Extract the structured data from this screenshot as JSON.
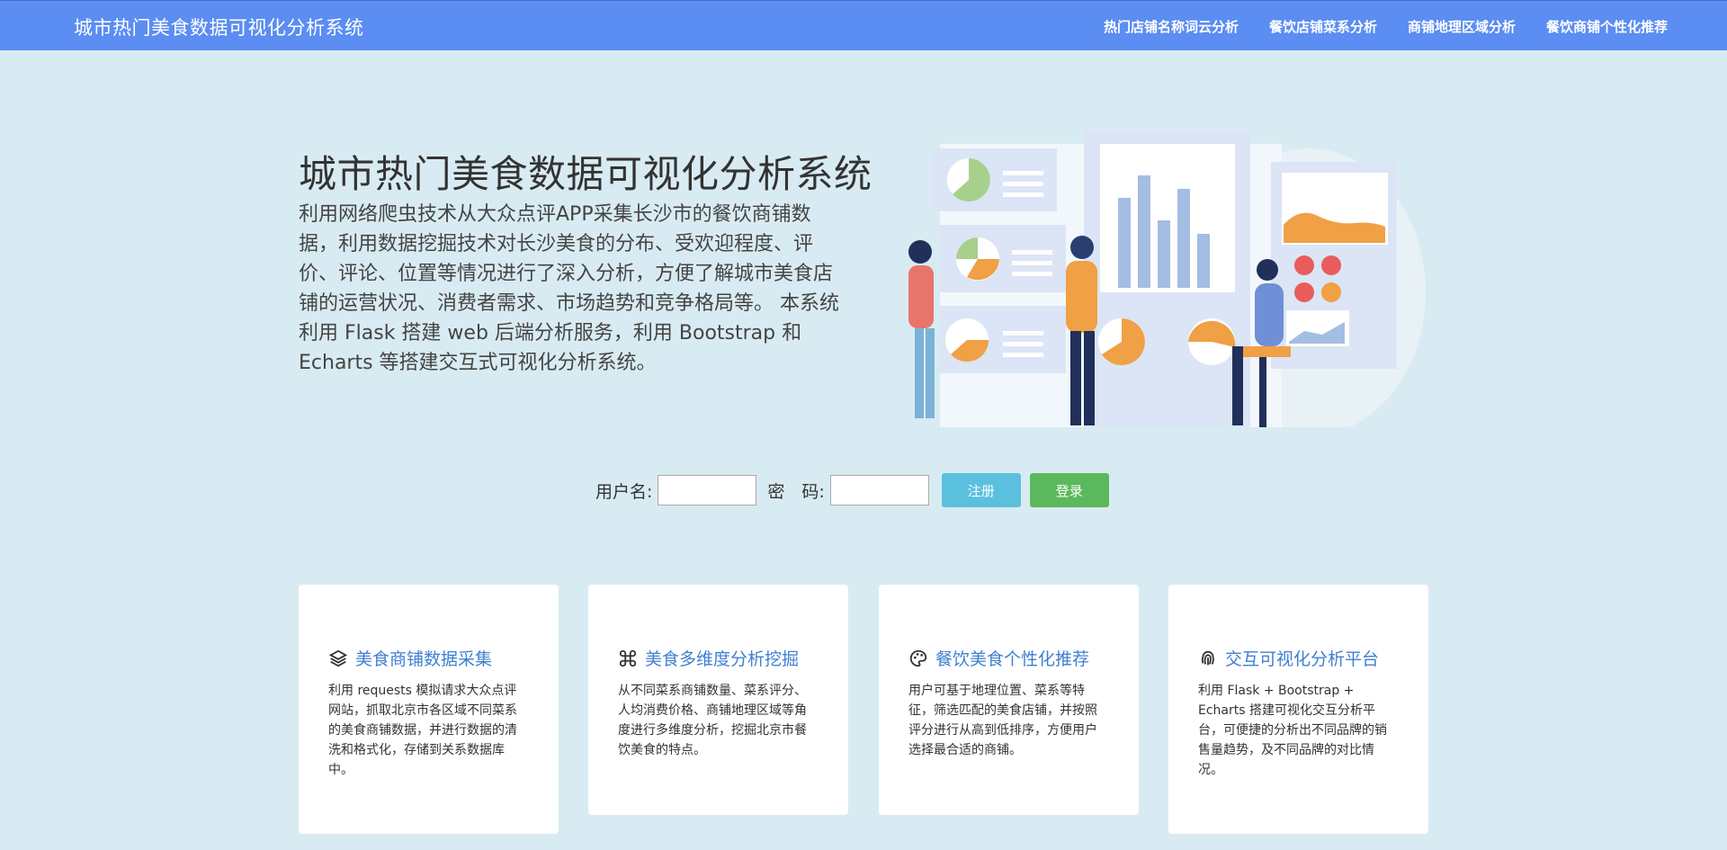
{
  "nav": {
    "brand": "城市热门美食数据可视化分析系统",
    "links": [
      "热门店铺名称词云分析",
      "餐饮店铺菜系分析",
      "商铺地理区域分析",
      "餐饮商铺个性化推荐"
    ]
  },
  "hero": {
    "title": "城市热门美食数据可视化分析系统",
    "description": "利用网络爬虫技术从大众点评APP采集长沙市的餐饮商铺数据，利用数据挖掘技术对长沙美食的分布、受欢迎程度、评价、评论、位置等情况进行了深入分析，方便了解城市美食店铺的运营状况、消费者需求、市场趋势和竞争格局等。 本系统利用 Flask 搭建 web 后端分析服务，利用 Bootstrap 和 Echarts 等搭建交互式可视化分析系统。"
  },
  "login": {
    "username_label": "用户名:",
    "username_value": "",
    "password_label": "密　码:",
    "password_value": "",
    "register_button": "注册",
    "login_button": "登录"
  },
  "cards": [
    {
      "icon": "layers-icon",
      "title": "美食商铺数据采集",
      "text": "利用 requests 模拟请求大众点评网站，抓取北京市各区域不同菜系的美食商铺数据，并进行数据的清洗和格式化，存储到关系数据库中。"
    },
    {
      "icon": "command-icon",
      "title": "美食多维度分析挖掘",
      "text": "从不同菜系商铺数量、菜系评分、人均消费价格、商铺地理区域等角度进行多维度分析，挖掘北京市餐饮美食的特点。"
    },
    {
      "icon": "palette-icon",
      "title": "餐饮美食个性化推荐",
      "text": "用户可基于地理位置、菜系等特征，筛选匹配的美食店铺，并按照评分进行从高到低排序，方便用户选择最合适的商铺。"
    },
    {
      "icon": "fingerprint-icon",
      "title": "交互可视化分析平台",
      "text": "利用 Flask + Bootstrap + Echarts 搭建可视化交互分析平台，可便捷的分析出不同品牌的销售量趋势，及不同品牌的对比情况。"
    }
  ],
  "colors": {
    "navbar": "#5b8df2",
    "background": "#d9ebf2",
    "card_title": "#3f7fd0",
    "register": "#5bc0de",
    "login": "#5cb85c"
  }
}
